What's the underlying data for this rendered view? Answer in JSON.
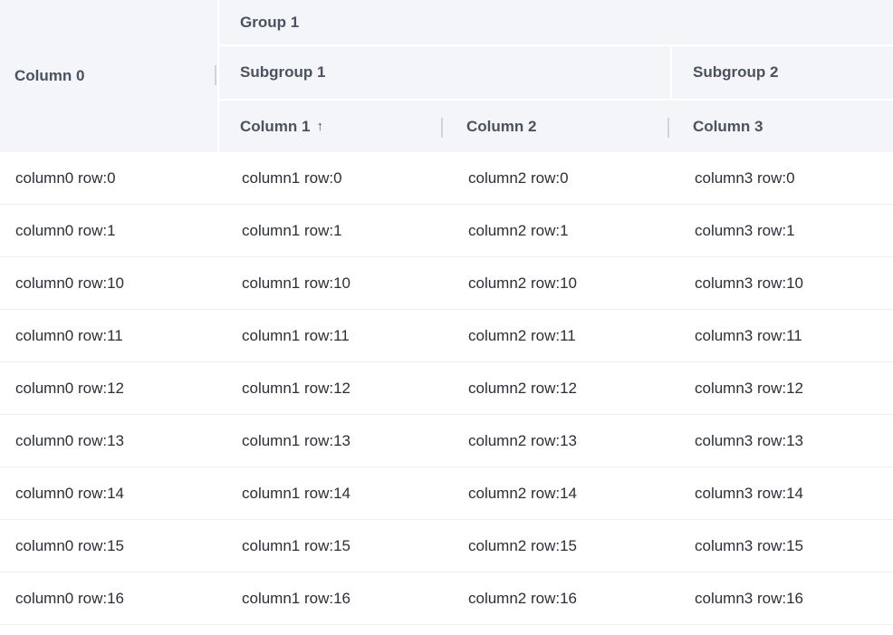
{
  "header": {
    "column0": "Column 0",
    "group1": "Group 1",
    "subgroup1": "Subgroup 1",
    "subgroup2": "Subgroup 2",
    "column1": "Column 1",
    "column1_sort_icon": "↑",
    "column2": "Column 2",
    "column3": "Column 3"
  },
  "rows": [
    [
      "column0 row:0",
      "column1 row:0",
      "column2 row:0",
      "column3 row:0"
    ],
    [
      "column0 row:1",
      "column1 row:1",
      "column2 row:1",
      "column3 row:1"
    ],
    [
      "column0 row:10",
      "column1 row:10",
      "column2 row:10",
      "column3 row:10"
    ],
    [
      "column0 row:11",
      "column1 row:11",
      "column2 row:11",
      "column3 row:11"
    ],
    [
      "column0 row:12",
      "column1 row:12",
      "column2 row:12",
      "column3 row:12"
    ],
    [
      "column0 row:13",
      "column1 row:13",
      "column2 row:13",
      "column3 row:13"
    ],
    [
      "column0 row:14",
      "column1 row:14",
      "column2 row:14",
      "column3 row:14"
    ],
    [
      "column0 row:15",
      "column1 row:15",
      "column2 row:15",
      "column3 row:15"
    ],
    [
      "column0 row:16",
      "column1 row:16",
      "column2 row:16",
      "column3 row:16"
    ]
  ],
  "colors": {
    "header_bg": "#f3f5f8",
    "header_text": "#4a525d",
    "cell_text": "#2b2f36",
    "row_border": "#eceef1"
  },
  "sort": {
    "column": "column1",
    "direction": "ascending",
    "icon": "arrow-up-icon"
  }
}
